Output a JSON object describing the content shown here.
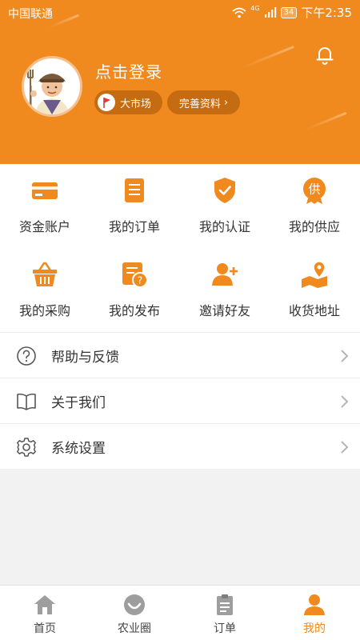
{
  "status_bar": {
    "carrier": "中国联通",
    "network": "4G",
    "battery": "34",
    "time": "下午2:35"
  },
  "header": {
    "login_prompt": "点击登录",
    "market_label": "大市场",
    "complete_profile_label": "完善资料",
    "complete_profile_arrow": "›"
  },
  "grid": [
    {
      "label": "资金账户",
      "icon": "wallet-card-icon"
    },
    {
      "label": "我的订单",
      "icon": "order-list-icon"
    },
    {
      "label": "我的认证",
      "icon": "shield-check-icon"
    },
    {
      "label": "我的供应",
      "icon": "supply-badge-icon",
      "glyph": "供"
    },
    {
      "label": "我的采购",
      "icon": "basket-icon"
    },
    {
      "label": "我的发布",
      "icon": "publish-icon"
    },
    {
      "label": "邀请好友",
      "icon": "add-friend-icon"
    },
    {
      "label": "收货地址",
      "icon": "map-pin-icon"
    }
  ],
  "menu": [
    {
      "label": "帮助与反馈",
      "icon": "question-icon"
    },
    {
      "label": "关于我们",
      "icon": "book-icon"
    },
    {
      "label": "系统设置",
      "icon": "gear-icon"
    }
  ],
  "tabbar": [
    {
      "label": "首页",
      "icon": "home-icon",
      "active": false
    },
    {
      "label": "农业圈",
      "icon": "circle-smile-icon",
      "active": false
    },
    {
      "label": "订单",
      "icon": "clipboard-icon",
      "active": false
    },
    {
      "label": "我的",
      "icon": "person-icon",
      "active": true
    }
  ],
  "colors": {
    "accent": "#f08a1e",
    "pill": "#c56c12",
    "icon_inactive": "#9e9e9e"
  }
}
